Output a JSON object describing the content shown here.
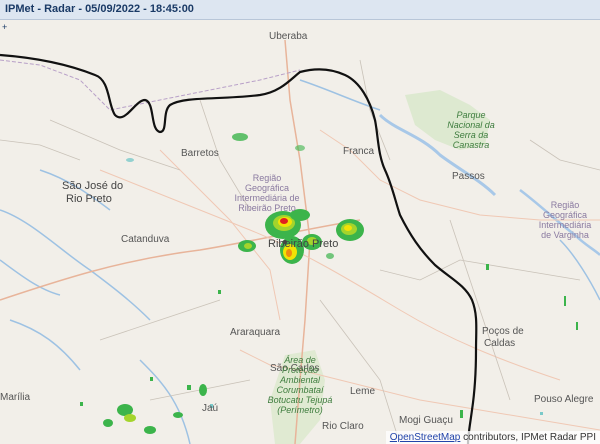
{
  "window": {
    "title": "IPMet - Radar - 05/09/2022 - 18:45:00"
  },
  "map": {
    "zoom_control_glyph": "+",
    "cities": [
      {
        "name": "Uberaba"
      },
      {
        "name": "Franca"
      },
      {
        "name": "Barretos"
      },
      {
        "name": "São José do"
      },
      {
        "name": "Rio Preto"
      },
      {
        "name": "Passos"
      },
      {
        "name": "Catanduva"
      },
      {
        "name": "Araraquara"
      },
      {
        "name": "São Carlos"
      },
      {
        "name": "Poços de"
      },
      {
        "name": "Caldas"
      },
      {
        "name": "Leme"
      },
      {
        "name": "Pouso Alegre"
      },
      {
        "name": "Rio Claro"
      },
      {
        "name": "Marília"
      },
      {
        "name": "Jaú"
      },
      {
        "name": "Mogi Guaçu"
      }
    ],
    "regions": [
      {
        "name": "Região Geográfica Intermediária de Ribeirão Preto"
      },
      {
        "name": "Região Geográfica Intermediária de Varginha"
      }
    ],
    "parks": [
      {
        "name": "Parque Nacional da Serra da Canastra"
      },
      {
        "name": "Área de Proteção Ambiental Corumbataí Botucatu Tejupá (Perímetro)"
      }
    ],
    "overlay_city": {
      "name": "Ribeirão Preto"
    },
    "border_color": "#111111",
    "radar_colors": {
      "light": "#3cb44b",
      "moderate": "#a4d42c",
      "heavy": "#f2e205",
      "intense": "#f08a10",
      "severe": "#e02020",
      "weak": "#7ac9c9"
    }
  },
  "attribution": {
    "link_text": "OpenStreetMap",
    "rest_text": " contributors, IPMet Radar PPI"
  }
}
